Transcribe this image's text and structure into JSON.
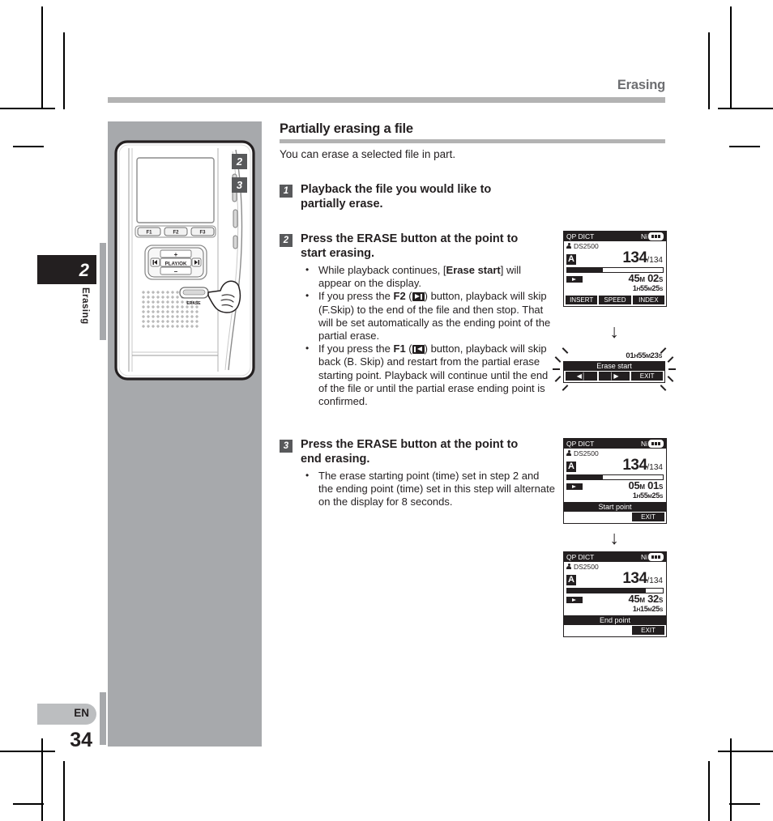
{
  "running_head": "Erasing",
  "chapter_tab": {
    "number": "2",
    "label": "Erasing"
  },
  "footer": {
    "language_badge": "EN",
    "page_number": "34"
  },
  "section": {
    "title": "Partially erasing a file",
    "intro": "You can erase a selected file in part."
  },
  "device_callouts": {
    "two": "2",
    "three": "3"
  },
  "device_labels": {
    "f1": "F1",
    "f2": "F2",
    "f3": "F3",
    "play_ok": "PLAY/OK",
    "plus": "+",
    "minus": "–",
    "erase": "ERASE"
  },
  "steps": [
    {
      "badge": "1",
      "title": "Playback the file you would like to partially erase.",
      "bullets": []
    },
    {
      "badge": "2",
      "title": "Press the ERASE button at the point to start erasing.",
      "bullets": [
        "While playback continues, [Erase start] will appear on the display.",
        "If you press the F2 ( ) button, playback will skip (F.Skip) to the end of the file and then stop. That will be set automatically as the ending point of the partial erase.",
        "If you press the F1 ( ) button, playback will skip back (B. Skip) and restart from the partial erase starting point. Playback will continue until the end of the file or until the partial erase ending point is confirmed."
      ]
    },
    {
      "badge": "3",
      "title": "Press the ERASE button at the point to end erasing.",
      "bullets": [
        "The erase starting point (time) set in step 2 and the ending point (time) set in this step will alternate on the display for 8 seconds."
      ]
    }
  ],
  "bullet_fragments": {
    "b2_1a": "While playback continues, [",
    "b2_1b": "Erase start",
    "b2_1c": "] will appear on the display.",
    "b2_2a": "If you press the ",
    "b2_2b": "F2",
    "b2_2c": " (",
    "b2_2d": ") button, playback will skip (F.Skip) to the end of the file and then stop. That will be set automatically as the ending point of the partial erase.",
    "b2_3a": "If you press the ",
    "b2_3b": "F1",
    "b2_3c": " (",
    "b2_3d": ") button, playback will skip back (B. Skip) and restart from the partial erase starting point. Playback will continue until the end of the file or until the partial erase ending point is confirmed.",
    "b3_1": "The erase starting point (time) set in step 2 and the ending point (time) set in this step will alternate on the display for 8 seconds.",
    "step1_l1": "Playback the file you would like to",
    "step1_l2": "partially erase.",
    "step2_l1a": "Press the ",
    "step2_l1b": "ERASE",
    "step2_l1c": " button at the point to",
    "step2_l2": "start erasing.",
    "step3_l2": "end erasing."
  },
  "lcd_screens": [
    {
      "id": "playback",
      "mode": "QP DICT",
      "battery_label": "Ni",
      "author": "DS2500",
      "folder": "A",
      "file_index": "134",
      "file_total": "/134",
      "progress_percent": 37,
      "elapsed_min": "45",
      "elapsed_min_unit": "M",
      "elapsed_sec": "02",
      "elapsed_sec_unit": "S",
      "total_hour": "1",
      "total_hour_unit": "H",
      "total_min": "55",
      "total_min_unit": "M",
      "total_sec": "25",
      "total_sec_unit": "S",
      "soft_keys": [
        "INSERT",
        "SPEED",
        "INDEX"
      ]
    },
    {
      "id": "erase-start",
      "time_hour": "01",
      "time_hour_unit": "H",
      "time_min": "55",
      "time_min_unit": "M",
      "time_sec": "23",
      "time_sec_unit": "S",
      "banner": "Erase start",
      "soft_keys": [
        "◀│",
        "│▶",
        "EXIT"
      ]
    },
    {
      "id": "start-point",
      "mode": "QP DICT",
      "battery_label": "Ni",
      "author": "DS2500",
      "folder": "A",
      "file_index": "134",
      "file_total": "/134",
      "progress_percent": 37,
      "elapsed_min": "05",
      "elapsed_min_unit": "M",
      "elapsed_sec": "01",
      "elapsed_sec_unit": "S",
      "total_hour": "1",
      "total_hour_unit": "H",
      "total_min": "55",
      "total_min_unit": "M",
      "total_sec": "25",
      "total_sec_unit": "S",
      "banner": "Start point",
      "soft_keys": [
        "EXIT"
      ]
    },
    {
      "id": "end-point",
      "mode": "QP DICT",
      "battery_label": "Ni",
      "author": "DS2500",
      "folder": "A",
      "file_index": "134",
      "file_total": "/134",
      "progress_percent": 82,
      "elapsed_min": "45",
      "elapsed_min_unit": "M",
      "elapsed_sec": "32",
      "elapsed_sec_unit": "S",
      "total_hour": "1",
      "total_hour_unit": "H",
      "total_min": "15",
      "total_min_unit": "M",
      "total_sec": "25",
      "total_sec_unit": "S",
      "banner": "End point",
      "soft_keys": [
        "EXIT"
      ]
    }
  ],
  "arrow_glyph": "↓",
  "colors": {
    "rule_gray": "#b3b3b3",
    "panel_gray": "#a7a9ac",
    "badge_dark": "#58595b",
    "ink": "#231f20"
  }
}
